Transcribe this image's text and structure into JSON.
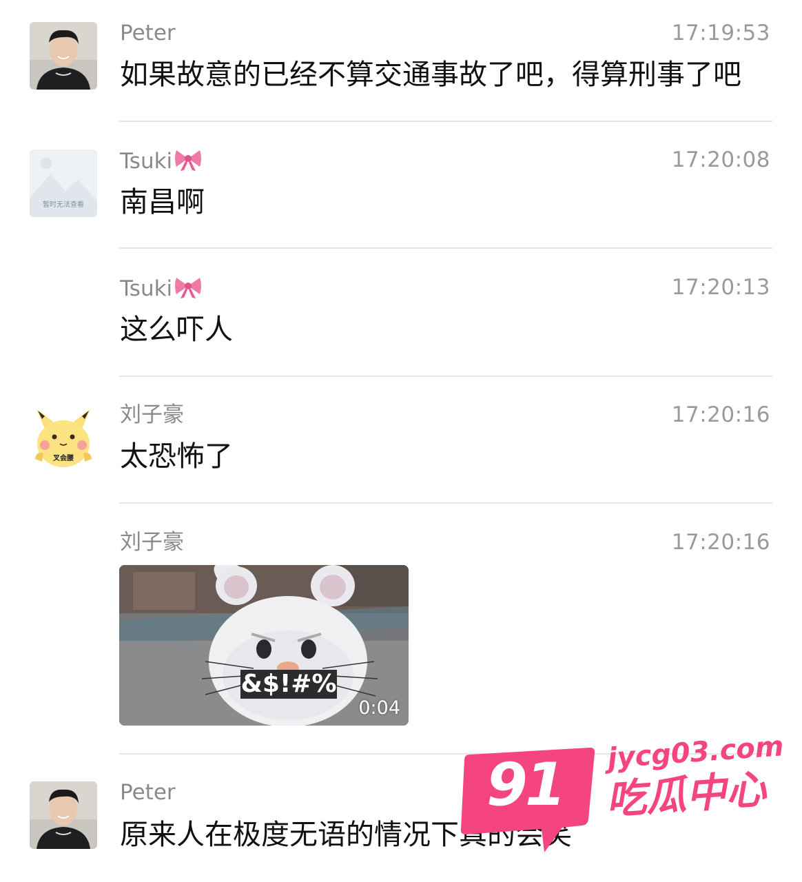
{
  "messages": [
    {
      "sender": "Peter",
      "time": "17:19:53",
      "text": "如果故意的已经不算交通事故了吧，得算刑事了吧",
      "avatar": "person-photo"
    },
    {
      "sender": "Tsuki",
      "time": "17:20:08",
      "text": "南昌啊",
      "avatar": "placeholder-image",
      "avatar_text": "暂时无法查看"
    },
    {
      "sender": "Tsuki",
      "time": "17:20:13",
      "text": "这么吓人"
    },
    {
      "sender": "刘子豪",
      "time": "17:20:16",
      "text": "太恐怖了",
      "avatar": "pikachu-sticker",
      "avatar_text": "叉会腰"
    },
    {
      "sender": "刘子豪",
      "time": "17:20:16",
      "video": {
        "caption": "&$!#%",
        "duration": "0:04"
      }
    },
    {
      "sender": "Peter",
      "time": "",
      "text": "原来人在极度无语的情况下真的会笑",
      "avatar": "person-photo"
    }
  ],
  "watermark": {
    "number": "91",
    "domain": "jycg03.com",
    "label": "吃瓜中心"
  },
  "colors": {
    "sender": "#8a8a8a",
    "time": "#9a9a9a",
    "divider": "#e6e6e6",
    "watermark_pink": "#f5457f"
  }
}
